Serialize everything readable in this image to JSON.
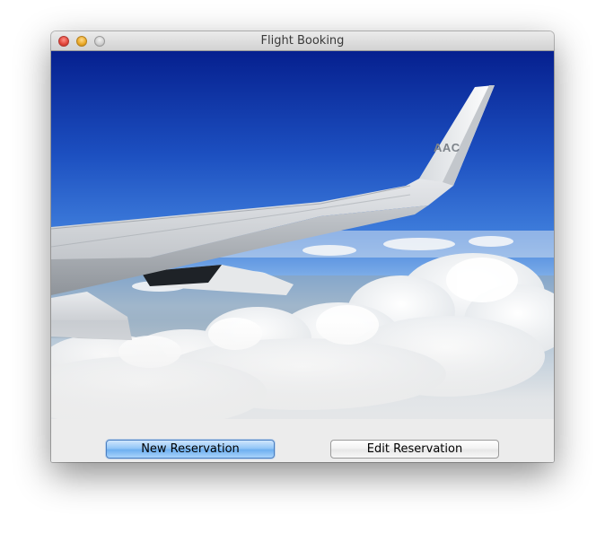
{
  "window": {
    "title": "Flight Booking"
  },
  "hero": {
    "wing_logo_text": "AAC"
  },
  "actions": {
    "new_reservation_label": "New Reservation",
    "edit_reservation_label": "Edit Reservation"
  },
  "colors": {
    "sky_top": "#0b2fa6",
    "sky_horizon": "#bcd6f3",
    "default_button": "#7ab8f3",
    "background": "#ececec"
  }
}
